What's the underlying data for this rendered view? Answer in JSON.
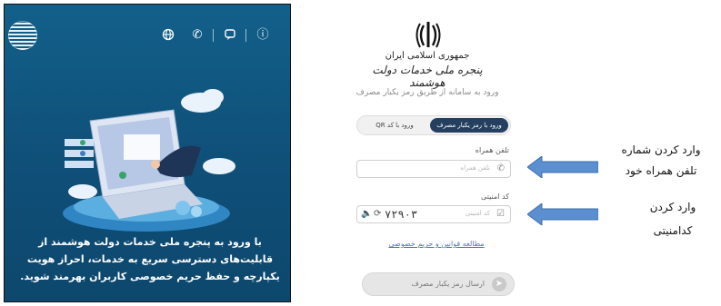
{
  "left_panel": {
    "top_icons": [
      "info-icon",
      "chat-icon",
      "phone-icon",
      "globe-icon"
    ],
    "promo_text": "با ورود به پنجره ملی خدمات دولت هوشمند از قابلیت‌های دسترسی سریع به خدمات، احراز هویت یکپارچه و حفظ حریم خصوصی کاربران بهرمند شوید."
  },
  "login": {
    "brand_line1": "جمهوری اسلامی ایران",
    "brand_line2": "پنجره ملی خدمات دولت هوشمند",
    "caption": "ورود به سامانه از طریق رمز یکبار مصرف",
    "tab_active": "ورود با رمز یکبار مصرف",
    "tab_inactive": "ورود با کد QR",
    "phone_label": "تلفن همراه",
    "phone_placeholder": "تلفن همراه",
    "captcha_label": "کد امنیتی",
    "captcha_placeholder": "کد امنیتی",
    "captcha_value": "۷۲۹۰۳",
    "rules_link": "مطالعه قوانین و حریم خصوصی",
    "send_button": "ارسال رمز یکبار مصرف"
  },
  "annotations": {
    "phone_note_line1": "وارد کردن شماره",
    "phone_note_line2": "تلفن همراه خود",
    "captcha_note_line1": "وارد کردن",
    "captcha_note_line2": "کدامنیتی"
  },
  "colors": {
    "panel_blue": "#12608a",
    "active_tab": "#243f5f",
    "link": "#5570c7",
    "arrow": "#5b8fd0"
  }
}
